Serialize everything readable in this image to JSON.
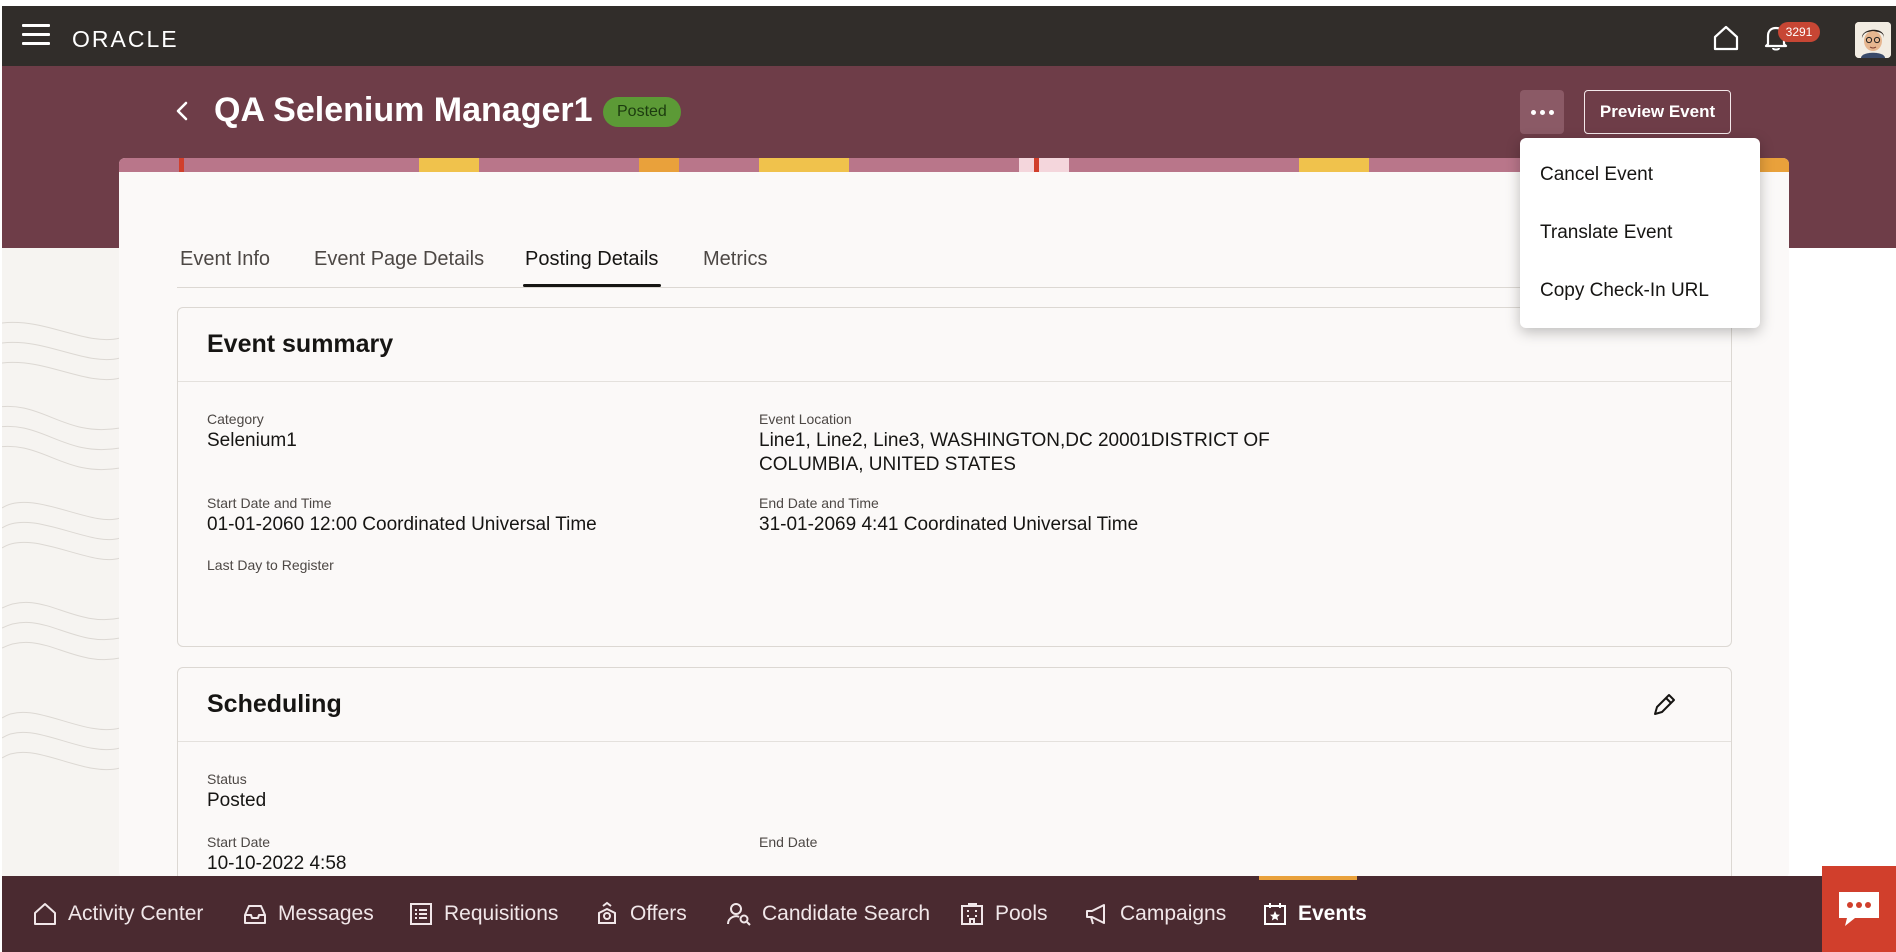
{
  "header": {
    "logo_text": "ORACLE",
    "notification_count": "3291"
  },
  "event": {
    "title": "QA Selenium Manager1",
    "status_badge": "Posted",
    "preview_label": "Preview Event"
  },
  "menu": {
    "items": [
      "Cancel Event",
      "Translate Event",
      "Copy Check-In URL"
    ]
  },
  "tabs": [
    "Event Info",
    "Event Page Details",
    "Posting Details",
    "Metrics"
  ],
  "active_tab": "Posting Details",
  "summary": {
    "heading": "Event summary",
    "category_label": "Category",
    "category_value": "Selenium1",
    "location_label": "Event Location",
    "location_value_line1": "Line1, Line2, Line3, WASHINGTON,DC 20001DISTRICT OF",
    "location_value_line2": "COLUMBIA, UNITED STATES",
    "start_label": "Start Date and Time",
    "start_value": "01-01-2060 12:00 Coordinated Universal Time",
    "end_label": "End Date and Time",
    "end_value": "31-01-2069 4:41 Coordinated Universal Time",
    "last_day_label": "Last Day to Register"
  },
  "scheduling": {
    "heading": "Scheduling",
    "status_label": "Status",
    "status_value": "Posted",
    "start_label": "Start Date",
    "start_value": "10-10-2022 4:58",
    "end_label": "End Date"
  },
  "bottom_nav": {
    "items": [
      "Activity Center",
      "Messages",
      "Requisitions",
      "Offers",
      "Candidate Search",
      "Pools",
      "Campaigns",
      "Events"
    ],
    "active": "Events"
  },
  "colors": {
    "topbar": "#312d2a",
    "band": "#6e3d48",
    "badge_green": "#5c9a36",
    "nav_bg": "#4a2a30",
    "nav_active": "#e9a13b",
    "chat": "#d13f2c"
  },
  "icons": [
    "hamburger-icon",
    "home-icon",
    "bell-icon",
    "avatar",
    "back-chevron-icon",
    "more-dots-icon",
    "edit-pencil-icon",
    "chat-icon"
  ]
}
